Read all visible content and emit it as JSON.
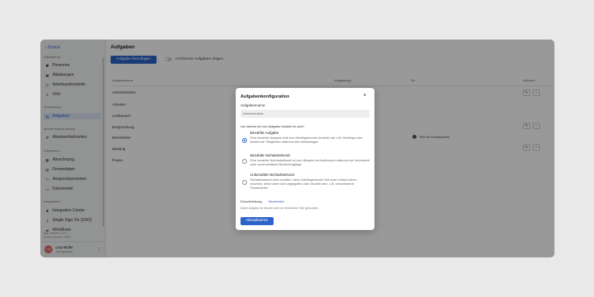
{
  "sidebar": {
    "back_label": "Zurück",
    "section_mitarbeitende": "Mitarbeitende",
    "items_mitarbeitende": [
      "Personen",
      "Abteilungen",
      "Arbeitszeitmodelle",
      "Orte"
    ],
    "section_zeiterfassung": "Zeiterfassung",
    "item_aufgaben": "Aufgaben",
    "section_abwesenheit": "Abwesenheitsverwaltung",
    "item_abwesenheitsarten": "Abwesenheitsarten",
    "section_organisation": "Organisation",
    "items_organisation": [
      "Abrechnung",
      "Firmendaten",
      "Ansprechpersonen",
      "Dokumente"
    ],
    "section_integrationen": "Integrationen",
    "items_integrationen": [
      "Integration Center",
      "Single Sign On (SSO)",
      "Workflows"
    ],
    "app_version": "App version: 3.23.1",
    "server_version": "Server version: 7.85.7",
    "user": {
      "initials": "LM",
      "name": "Lisa Müller",
      "role": "Management"
    }
  },
  "main": {
    "title": "Aufgaben",
    "add_button": "Aufgabe hinzufügen",
    "toggle_label": "Archivierte Aufgaben zeigen",
    "columns": {
      "name": "Aufgabenname",
      "type": "Aufgabentyp",
      "ort": "Ort",
      "actions": "Aktionen"
    },
    "rows": [
      {
        "name": "Administration",
        "ort": ""
      },
      {
        "name": "Arbeiten",
        "ort": ""
      },
      {
        "name": "Arztbesuch",
        "ort": ""
      },
      {
        "name": "Besprechung",
        "ort": ""
      },
      {
        "name": "Dienstreise",
        "ort": "TimeTac Headquarters"
      },
      {
        "name": "Meeting",
        "ort": ""
      },
      {
        "name": "Pause",
        "ort": ""
      }
    ]
  },
  "modal": {
    "title": "Aufgabenkonfiguration",
    "close": "×",
    "name_label": "Aufgabenname",
    "name_value": "Administration",
    "question": "Um welche Art von Aufgabe handelt es sich?",
    "options": [
      {
        "title": "Bezahlte Aufgabe",
        "desc": "Eine bezahlte Aufgabe wird vom Arbeitgebenden bezahlt, wie z.B. Meetings oder bestimmte Tätigkeiten während des Arbeitstages.",
        "selected": true
      },
      {
        "title": "Bezahlte Nichtarbeitszeit",
        "desc": "Eine bezahlte Nichtarbeitszeit ist zum Beispiel ein Arztbesuch während der Arbeitszeit oder unvermeidbare Behördengänge.",
        "selected": false
      },
      {
        "title": "Unbezahlte Nichtarbeitszeit",
        "desc": "Nichtarbeitszeit kann anfallen, wenn Arbeitsgebende Zeit zwar erfasst haben möchten, diese aber nicht abgegolten oder bezahlt wird, z.B. verschiedene Pausenarten.",
        "selected": false
      }
    ],
    "restriction_label": "Einschränkung",
    "edit_link": "Bearbeiten",
    "restriction_note": "Diese Aufgabe ist derzeit nicht an bestimmte Orte gebunden.",
    "save_button": "Aktualisieren"
  },
  "colors": {
    "accent": "#2d63c8",
    "overlay": "rgba(0,0,0,0.4)"
  }
}
